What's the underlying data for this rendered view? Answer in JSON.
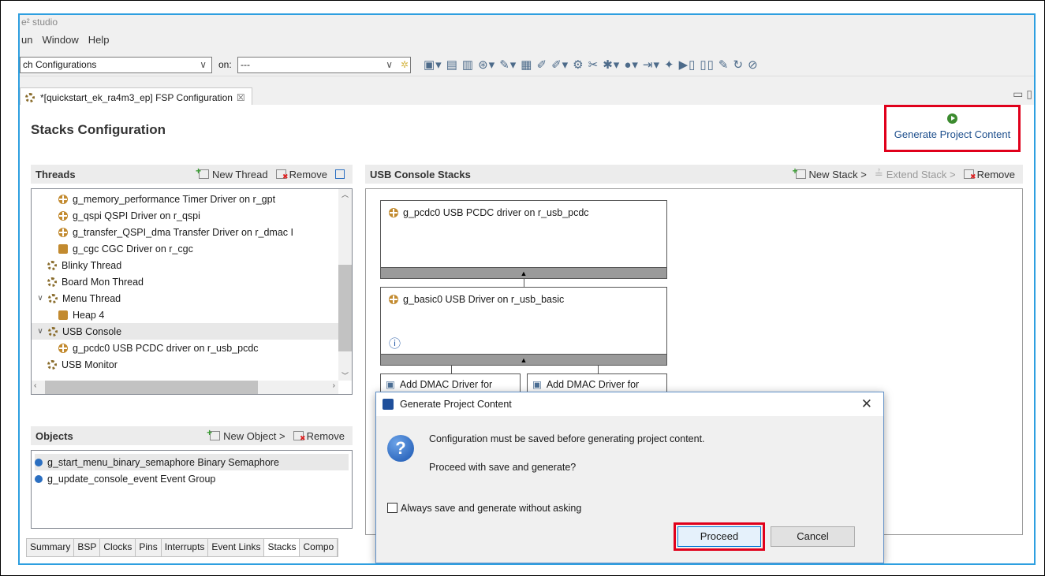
{
  "window": {
    "title": "e² studio",
    "menu": [
      "un",
      "Window",
      "Help"
    ]
  },
  "toolbar": {
    "launch_config": "ch Configurations",
    "on_label": "on:",
    "on_value": "---"
  },
  "editor_tab": {
    "label": "*[quickstart_ek_ra4m3_ep] FSP Configuration",
    "close": "☒"
  },
  "stacks": {
    "title": "Stacks Configuration",
    "generate_label": "Generate Project Content"
  },
  "threads": {
    "header": "Threads",
    "new_thread": "New Thread",
    "remove": "Remove",
    "items": [
      {
        "label": "g_memory_performance Timer Driver on r_gpt",
        "icon": "driver",
        "indent": 2
      },
      {
        "label": "g_qspi QSPI Driver on r_qspi",
        "icon": "driver",
        "indent": 2
      },
      {
        "label": "g_transfer_QSPI_dma Transfer Driver on r_dmac I",
        "icon": "driver",
        "indent": 2
      },
      {
        "label": "g_cgc CGC Driver on r_cgc",
        "icon": "heap",
        "indent": 2
      },
      {
        "label": "Blinky Thread",
        "icon": "thread",
        "indent": 1
      },
      {
        "label": "Board Mon Thread",
        "icon": "thread",
        "indent": 1
      },
      {
        "label": "Menu Thread",
        "icon": "thread",
        "indent": 0,
        "caret": "∨"
      },
      {
        "label": "Heap 4",
        "icon": "heap",
        "indent": 2
      },
      {
        "label": "USB Console",
        "icon": "thread",
        "indent": 0,
        "caret": "∨",
        "selected": true
      },
      {
        "label": "g_pcdc0 USB PCDC driver on r_usb_pcdc",
        "icon": "driver",
        "indent": 2
      },
      {
        "label": "USB Monitor",
        "icon": "thread",
        "indent": 1
      }
    ]
  },
  "objects": {
    "header": "Objects",
    "new_object": "New Object >",
    "remove": "Remove",
    "items": [
      "g_start_menu_binary_semaphore Binary Semaphore",
      "g_update_console_event Event Group"
    ]
  },
  "usb_stacks": {
    "header": "USB Console Stacks",
    "new_stack": "New Stack >",
    "extend_stack": "Extend Stack >",
    "remove": "Remove",
    "box1": "g_pcdc0 USB PCDC driver on r_usb_pcdc",
    "box2": "g_basic0 USB Driver on r_usb_basic",
    "info": "ⓘ",
    "add1": "Add DMAC Driver for",
    "add2": "Add DMAC Driver for"
  },
  "bottom_tabs": [
    "Summary",
    "BSP",
    "Clocks",
    "Pins",
    "Interrupts",
    "Event Links",
    "Stacks",
    "Compo"
  ],
  "dialog": {
    "title": "Generate Project Content",
    "message": "Configuration must be saved before generating project content.",
    "question": "Proceed with save and generate?",
    "checkbox": "Always save and generate without asking",
    "proceed": "Proceed",
    "cancel": "Cancel"
  }
}
